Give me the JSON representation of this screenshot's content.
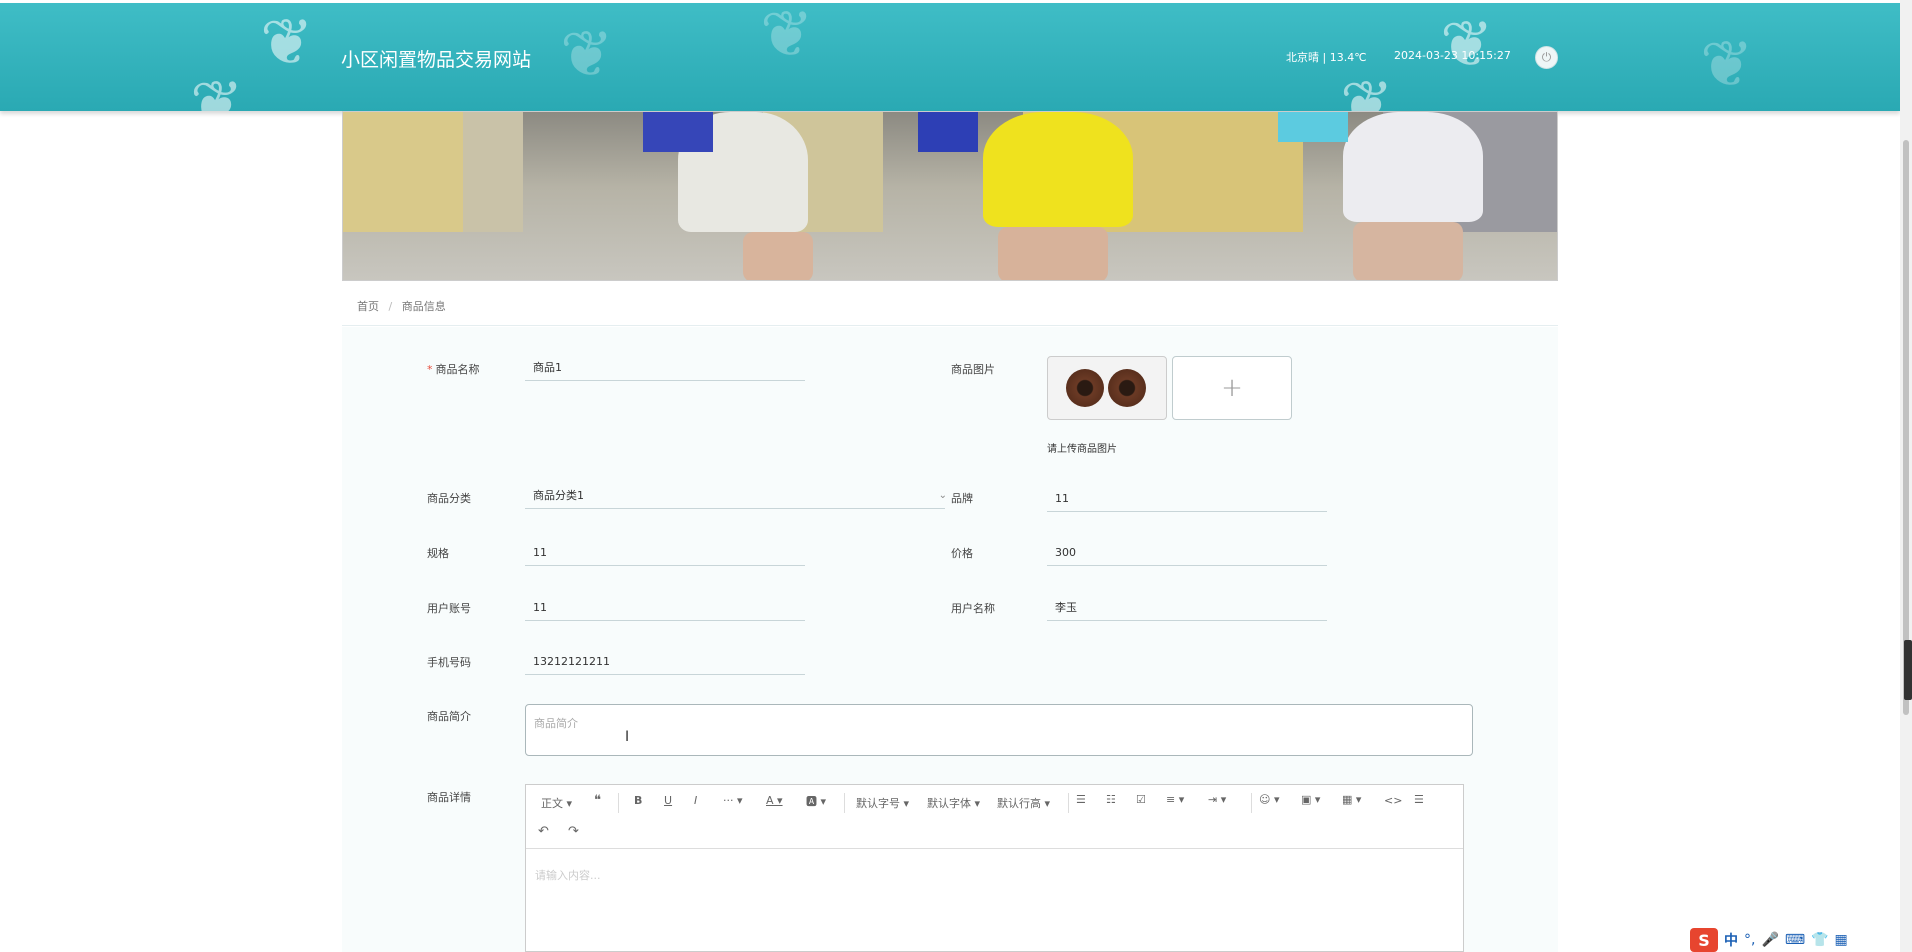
{
  "header": {
    "site_title": "小区闲置物品交易网站",
    "weather": "北京晴 | 13.4℃",
    "datetime": "2024-03-23  10:15:27",
    "logout_icon": "power-icon"
  },
  "breadcrumb": {
    "home": "首页",
    "separator": "/",
    "current": "商品信息"
  },
  "form": {
    "name": {
      "label": "商品名称",
      "value": "商品1",
      "required": true
    },
    "image": {
      "label": "商品图片",
      "hint": "请上传商品图片",
      "add_icon": "+"
    },
    "category": {
      "label": "商品分类",
      "value": "商品分类1"
    },
    "brand": {
      "label": "品牌",
      "value": "11"
    },
    "spec": {
      "label": "规格",
      "value": "11"
    },
    "price": {
      "label": "价格",
      "value": "300"
    },
    "account": {
      "label": "用户账号",
      "value": "11"
    },
    "username": {
      "label": "用户名称",
      "value": "李玉"
    },
    "phone": {
      "label": "手机号码",
      "value": "13212121211"
    },
    "intro": {
      "label": "商品简介",
      "placeholder": "商品简介"
    },
    "detail": {
      "label": "商品详情",
      "placeholder": "请输入内容..."
    }
  },
  "editor_toolbar": {
    "paragraph": "正文",
    "font_size": "默认字号",
    "font_family": "默认字体",
    "line_height": "默认行高",
    "icons": [
      "quote-icon",
      "bold-icon",
      "underline-icon",
      "italic-icon",
      "more-icon",
      "font-color-icon",
      "bg-color-icon",
      "bullet-list-icon",
      "numbered-list-icon",
      "todo-icon",
      "align-icon",
      "indent-icon",
      "emoji-icon",
      "image-icon",
      "table-icon",
      "code-icon",
      "divider-icon",
      "undo-icon",
      "redo-icon"
    ]
  },
  "ime": {
    "label": "中"
  },
  "colors": {
    "header": "#35b3bd",
    "required": "#e74c3c",
    "border": "#c8d5d8"
  }
}
